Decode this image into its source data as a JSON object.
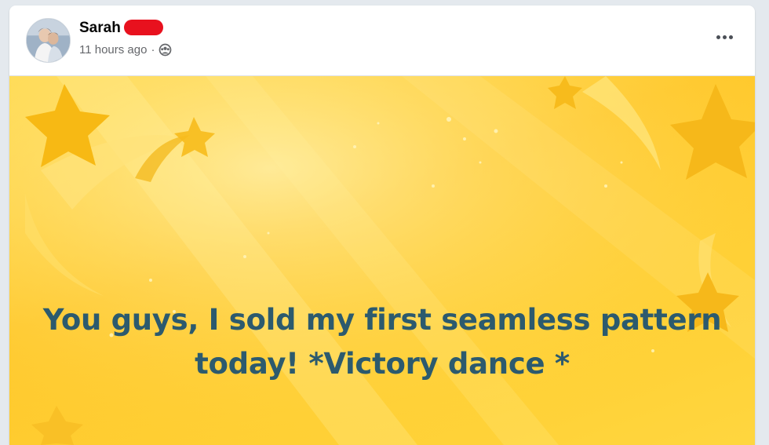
{
  "post": {
    "author_name": "Sarah",
    "timestamp": "11 hours ago",
    "separator": "·",
    "audience_icon": "globe-icon",
    "more_icon": "more-horizontal-icon",
    "text_line1": "You guys, I sold my first seamless pattern",
    "text_line2": "today! *Victory dance *"
  },
  "colors": {
    "banner_background": "#ffc72a",
    "banner_text": "#2c5a6e",
    "redaction": "#e8111e"
  }
}
